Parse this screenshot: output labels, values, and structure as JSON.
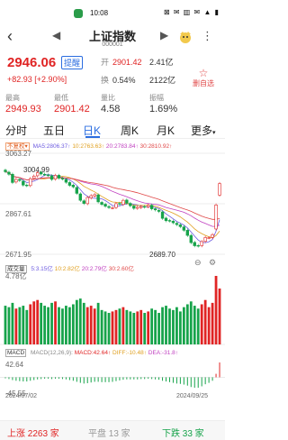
{
  "status": {
    "time": "10:08",
    "system_icons": "⊠ ✉ ▥ ✉ ▲ ▮"
  },
  "header": {
    "title": "上证指数",
    "code": "000001"
  },
  "quote": {
    "price": "2946.06",
    "remind_label": "提醒",
    "change": "+82.93",
    "change_pct": "[+2.90%]",
    "open_label": "开",
    "open_value": "2901.42",
    "volume_value": "2.41亿",
    "turnover_label": "换",
    "turnover_value": "0.54%",
    "amount_value": "2122亿",
    "add_watch_label": "删自选"
  },
  "metrics": [
    {
      "label": "最高",
      "value": "2949.93",
      "color": "red"
    },
    {
      "label": "最低",
      "value": "2901.42",
      "color": "red"
    },
    {
      "label": "量比",
      "value": "4.58",
      "color": "dark"
    },
    {
      "label": "振幅",
      "value": "1.69%",
      "color": "dark"
    }
  ],
  "tabs": [
    "分时",
    "五日",
    "日K",
    "周K",
    "月K",
    "更多"
  ],
  "active_tab": "日K",
  "ma_legend": {
    "fq": "不复权",
    "ma5": "MA5:2806.37↑",
    "ma10": "10:2763.63↑",
    "ma20": "20:2783.84↑",
    "ma30": "30:2810.92↑"
  },
  "price_axis": {
    "top": "3063.27",
    "mid": "2867.61",
    "bottom": "2671.95"
  },
  "annotations": {
    "high": "3004.99",
    "low": "2689.70"
  },
  "volume": {
    "title": "成交量",
    "v5": "5:3.15亿",
    "v10": "10:2.82亿",
    "v20": "20:2.79亿",
    "v30": "30:2.60亿",
    "max_label": "4.78亿"
  },
  "macd": {
    "title": "MACD",
    "params": "MACD(12,26,9):",
    "macd": "MACD:42.64↑",
    "diff": "DIFF:-10.48↑",
    "dea": "DEA:-31.8↑",
    "top": "42.64",
    "bottom": "-45.55"
  },
  "dates": {
    "start": "2024/07/02",
    "end": "2024/09/25"
  },
  "footer": {
    "up": "上涨 2263 家",
    "flat": "平盘 13 家",
    "down": "下跌 33 家"
  },
  "colors": {
    "up": "#e02424",
    "down": "#16a34a",
    "accent": "#2b6de0",
    "ma5": "#6d5be0",
    "ma10": "#e0a020",
    "ma20": "#c040c0",
    "ma30": "#e04848"
  },
  "chart_data": {
    "type": "candlestick",
    "dates": [
      "2024/07/02",
      "2024/09/25"
    ],
    "ylim": [
      2671.95,
      3063.27
    ],
    "series": [
      {
        "name": "上证指数",
        "values": [
          2992,
          2982,
          2950,
          2962,
          2958,
          2940,
          2938,
          2965,
          2975,
          2988,
          2983,
          2981,
          2978,
          2962,
          2978,
          2967,
          2964,
          2951,
          2939,
          2933,
          2908,
          2881,
          2869,
          2892,
          2899,
          2903,
          2875,
          2865,
          2858,
          2853,
          2852,
          2868,
          2866,
          2881,
          2870,
          2860,
          2850,
          2854,
          2857,
          2855,
          2862,
          2848,
          2844,
          2838,
          2811,
          2802,
          2801,
          2794,
          2787,
          2779,
          2765,
          2745,
          2717,
          2705,
          2704,
          2721,
          2737,
          2736,
          2748,
          2863,
          2946
        ],
        "note_open": [
          2998,
          2990,
          2982,
          2952,
          2962,
          2955,
          2940,
          2938,
          2966,
          2976,
          2990,
          2982,
          2979,
          2976,
          2963,
          2978,
          2966,
          2962,
          2950,
          2940,
          2931,
          2906,
          2879,
          2868,
          2890,
          2898,
          2902,
          2873,
          2866,
          2857,
          2852,
          2853,
          2869,
          2865,
          2882,
          2869,
          2859,
          2850,
          2853,
          2857,
          2856,
          2862,
          2848,
          2842,
          2836,
          2812,
          2803,
          2800,
          2792,
          2786,
          2778,
          2765,
          2745,
          2718,
          2706,
          2705,
          2722,
          2736,
          2737,
          2770,
          2901
        ]
      }
    ],
    "volume": [
      2.7,
      2.6,
      2.9,
      2.5,
      2.6,
      2.7,
      2.4,
      2.8,
      3.0,
      3.1,
      2.9,
      2.7,
      2.6,
      2.9,
      3.0,
      2.6,
      2.5,
      2.7,
      2.6,
      2.8,
      3.1,
      3.2,
      2.9,
      2.6,
      2.7,
      2.5,
      2.9,
      2.4,
      2.3,
      2.2,
      2.3,
      2.4,
      2.5,
      2.6,
      2.4,
      2.3,
      2.2,
      2.3,
      2.4,
      2.2,
      2.3,
      2.5,
      2.4,
      2.2,
      2.6,
      2.7,
      2.5,
      2.4,
      2.6,
      2.3,
      2.6,
      2.8,
      3.0,
      2.7,
      2.5,
      2.8,
      3.1,
      2.6,
      2.9,
      4.78,
      3.9
    ],
    "volume_max": 4.78,
    "macd_hist": [
      -3,
      -5,
      -8,
      -10,
      -11,
      -12,
      -12,
      -10,
      -8,
      -6,
      -5,
      -4,
      -4,
      -5,
      -4,
      -4,
      -5,
      -6,
      -8,
      -10,
      -13,
      -16,
      -18,
      -17,
      -15,
      -13,
      -13,
      -14,
      -14,
      -14,
      -13,
      -11,
      -9,
      -7,
      -6,
      -6,
      -6,
      -6,
      -5,
      -5,
      -4,
      -5,
      -6,
      -7,
      -10,
      -12,
      -14,
      -16,
      -18,
      -19,
      -21,
      -24,
      -28,
      -30,
      -30,
      -26,
      -20,
      -16,
      -10,
      10,
      42.64
    ],
    "macd_ylim": [
      -45.55,
      42.64
    ]
  }
}
